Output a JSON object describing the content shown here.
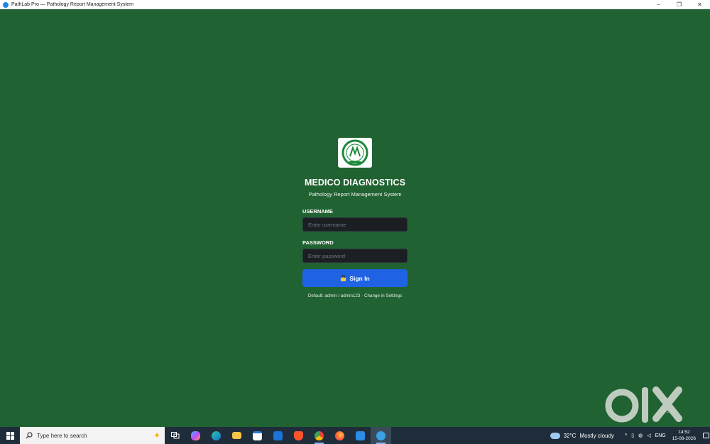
{
  "window": {
    "title": "PathLab Pro — Pathology Report Management System",
    "controls": {
      "minimize": "–",
      "restore": "❐",
      "close": "✕"
    }
  },
  "login": {
    "brand": "MEDICO DIAGNOSTICS",
    "subtitle": "Pathology Report Management System",
    "username_label": "USERNAME",
    "username_placeholder": "Enter username",
    "password_label": "PASSWORD",
    "password_placeholder": "Enter password",
    "signin_label": "Sign In",
    "hint": "Default: admin / admin123 · Change in Settings"
  },
  "watermark": {
    "india": "INDIA"
  },
  "taskbar": {
    "search_placeholder": "Type here to search",
    "apps": [
      "task-view-icon",
      "copilot-icon",
      "edge-icon",
      "file-explorer-icon",
      "calendar-icon",
      "outlook-icon",
      "brave-icon",
      "chrome-icon",
      "firefox-icon",
      "app-a-icon",
      "pathlab-app-icon"
    ],
    "weather": {
      "temp": "32°C",
      "condition": "Mostly cloudy"
    },
    "language": "ENG",
    "time": "14:52",
    "date": "15-08-2026"
  },
  "colors": {
    "background": "#216232",
    "accent": "#1f63e4",
    "input_bg": "#1b1f24",
    "taskbar": "#1f2d3b"
  }
}
